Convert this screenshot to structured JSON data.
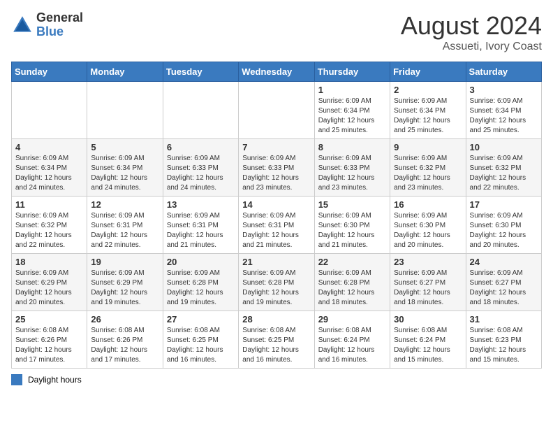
{
  "header": {
    "logo_general": "General",
    "logo_blue": "Blue",
    "month": "August 2024",
    "location": "Assueti, Ivory Coast"
  },
  "days_of_week": [
    "Sunday",
    "Monday",
    "Tuesday",
    "Wednesday",
    "Thursday",
    "Friday",
    "Saturday"
  ],
  "legend": {
    "label": "Daylight hours"
  },
  "weeks": [
    [
      {
        "day": "",
        "info": ""
      },
      {
        "day": "",
        "info": ""
      },
      {
        "day": "",
        "info": ""
      },
      {
        "day": "",
        "info": ""
      },
      {
        "day": "1",
        "info": "Sunrise: 6:09 AM\nSunset: 6:34 PM\nDaylight: 12 hours\nand 25 minutes."
      },
      {
        "day": "2",
        "info": "Sunrise: 6:09 AM\nSunset: 6:34 PM\nDaylight: 12 hours\nand 25 minutes."
      },
      {
        "day": "3",
        "info": "Sunrise: 6:09 AM\nSunset: 6:34 PM\nDaylight: 12 hours\nand 25 minutes."
      }
    ],
    [
      {
        "day": "4",
        "info": "Sunrise: 6:09 AM\nSunset: 6:34 PM\nDaylight: 12 hours\nand 24 minutes."
      },
      {
        "day": "5",
        "info": "Sunrise: 6:09 AM\nSunset: 6:34 PM\nDaylight: 12 hours\nand 24 minutes."
      },
      {
        "day": "6",
        "info": "Sunrise: 6:09 AM\nSunset: 6:33 PM\nDaylight: 12 hours\nand 24 minutes."
      },
      {
        "day": "7",
        "info": "Sunrise: 6:09 AM\nSunset: 6:33 PM\nDaylight: 12 hours\nand 23 minutes."
      },
      {
        "day": "8",
        "info": "Sunrise: 6:09 AM\nSunset: 6:33 PM\nDaylight: 12 hours\nand 23 minutes."
      },
      {
        "day": "9",
        "info": "Sunrise: 6:09 AM\nSunset: 6:32 PM\nDaylight: 12 hours\nand 23 minutes."
      },
      {
        "day": "10",
        "info": "Sunrise: 6:09 AM\nSunset: 6:32 PM\nDaylight: 12 hours\nand 22 minutes."
      }
    ],
    [
      {
        "day": "11",
        "info": "Sunrise: 6:09 AM\nSunset: 6:32 PM\nDaylight: 12 hours\nand 22 minutes."
      },
      {
        "day": "12",
        "info": "Sunrise: 6:09 AM\nSunset: 6:31 PM\nDaylight: 12 hours\nand 22 minutes."
      },
      {
        "day": "13",
        "info": "Sunrise: 6:09 AM\nSunset: 6:31 PM\nDaylight: 12 hours\nand 21 minutes."
      },
      {
        "day": "14",
        "info": "Sunrise: 6:09 AM\nSunset: 6:31 PM\nDaylight: 12 hours\nand 21 minutes."
      },
      {
        "day": "15",
        "info": "Sunrise: 6:09 AM\nSunset: 6:30 PM\nDaylight: 12 hours\nand 21 minutes."
      },
      {
        "day": "16",
        "info": "Sunrise: 6:09 AM\nSunset: 6:30 PM\nDaylight: 12 hours\nand 20 minutes."
      },
      {
        "day": "17",
        "info": "Sunrise: 6:09 AM\nSunset: 6:30 PM\nDaylight: 12 hours\nand 20 minutes."
      }
    ],
    [
      {
        "day": "18",
        "info": "Sunrise: 6:09 AM\nSunset: 6:29 PM\nDaylight: 12 hours\nand 20 minutes."
      },
      {
        "day": "19",
        "info": "Sunrise: 6:09 AM\nSunset: 6:29 PM\nDaylight: 12 hours\nand 19 minutes."
      },
      {
        "day": "20",
        "info": "Sunrise: 6:09 AM\nSunset: 6:28 PM\nDaylight: 12 hours\nand 19 minutes."
      },
      {
        "day": "21",
        "info": "Sunrise: 6:09 AM\nSunset: 6:28 PM\nDaylight: 12 hours\nand 19 minutes."
      },
      {
        "day": "22",
        "info": "Sunrise: 6:09 AM\nSunset: 6:28 PM\nDaylight: 12 hours\nand 18 minutes."
      },
      {
        "day": "23",
        "info": "Sunrise: 6:09 AM\nSunset: 6:27 PM\nDaylight: 12 hours\nand 18 minutes."
      },
      {
        "day": "24",
        "info": "Sunrise: 6:09 AM\nSunset: 6:27 PM\nDaylight: 12 hours\nand 18 minutes."
      }
    ],
    [
      {
        "day": "25",
        "info": "Sunrise: 6:08 AM\nSunset: 6:26 PM\nDaylight: 12 hours\nand 17 minutes."
      },
      {
        "day": "26",
        "info": "Sunrise: 6:08 AM\nSunset: 6:26 PM\nDaylight: 12 hours\nand 17 minutes."
      },
      {
        "day": "27",
        "info": "Sunrise: 6:08 AM\nSunset: 6:25 PM\nDaylight: 12 hours\nand 16 minutes."
      },
      {
        "day": "28",
        "info": "Sunrise: 6:08 AM\nSunset: 6:25 PM\nDaylight: 12 hours\nand 16 minutes."
      },
      {
        "day": "29",
        "info": "Sunrise: 6:08 AM\nSunset: 6:24 PM\nDaylight: 12 hours\nand 16 minutes."
      },
      {
        "day": "30",
        "info": "Sunrise: 6:08 AM\nSunset: 6:24 PM\nDaylight: 12 hours\nand 15 minutes."
      },
      {
        "day": "31",
        "info": "Sunrise: 6:08 AM\nSunset: 6:23 PM\nDaylight: 12 hours\nand 15 minutes."
      }
    ]
  ]
}
